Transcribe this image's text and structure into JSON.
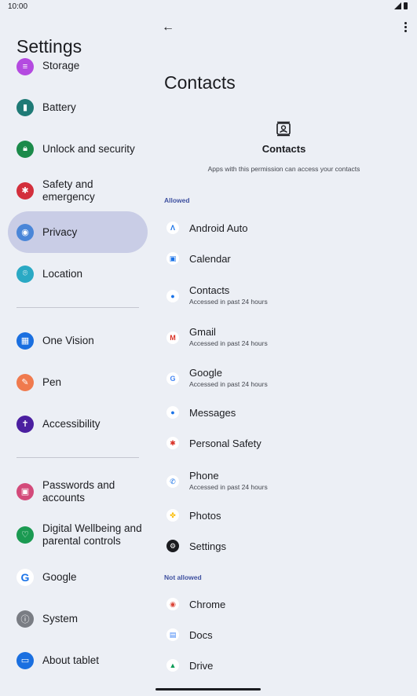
{
  "status": {
    "time": "10:00"
  },
  "left": {
    "title": "Settings",
    "items": [
      {
        "label": "Storage",
        "icon": "storage-icon",
        "color": "#b44ae0"
      },
      {
        "label": "Battery",
        "icon": "battery-icon",
        "color": "#1f7a76"
      },
      {
        "label": "Unlock and security",
        "icon": "lock-icon",
        "color": "#1b8a4a"
      },
      {
        "label": "Safety and emergency",
        "icon": "asterisk-icon",
        "color": "#d32f3c"
      },
      {
        "label": "Privacy",
        "icon": "privacy-eye-icon",
        "color": "#4a86d8"
      },
      {
        "label": "Location",
        "icon": "location-pin-icon",
        "color": "#2aa9c4"
      },
      {
        "label": "One Vision",
        "icon": "one-vision-icon",
        "color": "#1a6fe0"
      },
      {
        "label": "Pen",
        "icon": "pen-icon",
        "color": "#f07a4e"
      },
      {
        "label": "Accessibility",
        "icon": "accessibility-icon",
        "color": "#4b1fa0"
      },
      {
        "label": "Passwords and accounts",
        "icon": "accounts-icon",
        "color": "#d34a7a"
      },
      {
        "label": "Digital Wellbeing and parental controls",
        "icon": "wellbeing-icon",
        "color": "#1b9a52"
      },
      {
        "label": "Google",
        "icon": "google-icon",
        "color": "#1a73e8"
      },
      {
        "label": "System",
        "icon": "info-icon",
        "color": "#7a7d84"
      },
      {
        "label": "About tablet",
        "icon": "tablet-icon",
        "color": "#1a6fe0"
      }
    ]
  },
  "right": {
    "title": "Contacts",
    "permission_title": "Contacts",
    "permission_desc": "Apps with this permission can access your contacts",
    "allowed_label": "Allowed",
    "not_allowed_label": "Not allowed",
    "allowed": [
      {
        "name": "Android Auto",
        "sub": "",
        "icon": "android-auto-icon",
        "glyph": "Λ",
        "color": "#1a73e8"
      },
      {
        "name": "Calendar",
        "sub": "",
        "icon": "calendar-icon",
        "glyph": "▣",
        "color": "#1a73e8"
      },
      {
        "name": "Contacts",
        "sub": "Accessed in past 24 hours",
        "icon": "contacts-app-icon",
        "glyph": "●",
        "color": "#1a73e8"
      },
      {
        "name": "Gmail",
        "sub": "Accessed in past 24 hours",
        "icon": "gmail-icon",
        "glyph": "M",
        "color": "#d93025"
      },
      {
        "name": "Google",
        "sub": "Accessed in past 24 hours",
        "icon": "google-app-icon",
        "glyph": "G",
        "color": "#4285f4"
      },
      {
        "name": "Messages",
        "sub": "",
        "icon": "messages-icon",
        "glyph": "●",
        "color": "#1a73e8"
      },
      {
        "name": "Personal Safety",
        "sub": "",
        "icon": "personal-safety-icon",
        "glyph": "✱",
        "color": "#d93025"
      },
      {
        "name": "Phone",
        "sub": "Accessed in past 24 hours",
        "icon": "phone-icon",
        "glyph": "✆",
        "color": "#1a73e8"
      },
      {
        "name": "Photos",
        "sub": "",
        "icon": "photos-icon",
        "glyph": "✤",
        "color": "#fbbc04"
      },
      {
        "name": "Settings",
        "sub": "",
        "icon": "settings-gear-icon",
        "glyph": "⚙",
        "color": "#ffffff"
      }
    ],
    "not_allowed": [
      {
        "name": "Chrome",
        "sub": "",
        "icon": "chrome-icon",
        "glyph": "◉",
        "color": "#db4437"
      },
      {
        "name": "Docs",
        "sub": "",
        "icon": "docs-icon",
        "glyph": "▤",
        "color": "#4285f4"
      },
      {
        "name": "Drive",
        "sub": "",
        "icon": "drive-icon",
        "glyph": "▲",
        "color": "#0f9d58"
      }
    ]
  }
}
